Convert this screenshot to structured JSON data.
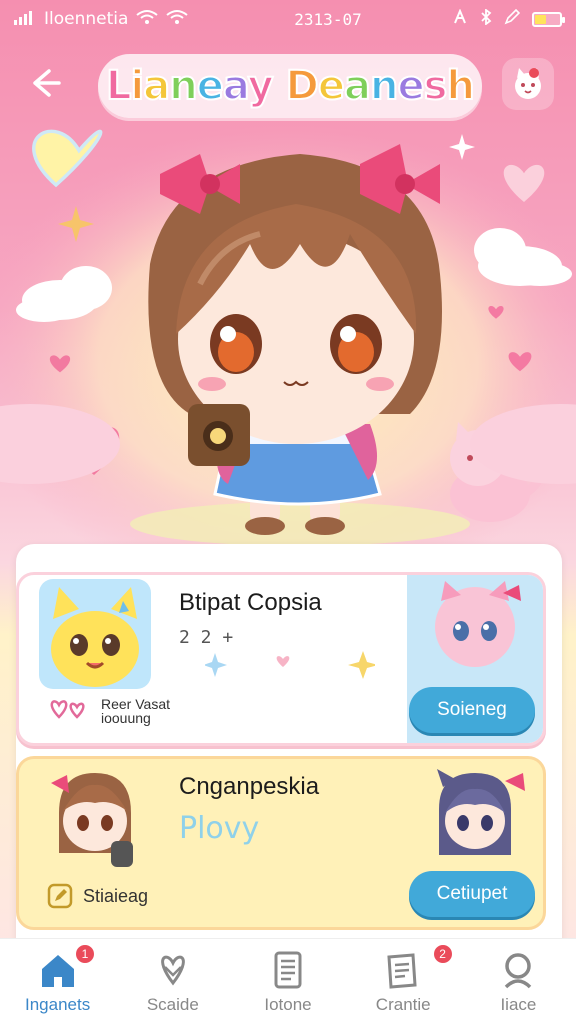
{
  "status_bar": {
    "carrier": "Iloennetia",
    "time": "2313-07",
    "battery_level": 0.45
  },
  "header": {
    "title": "Lianeay Deanesh",
    "back_icon": "back-arrow-icon",
    "profile_icon": "cat-profile-icon"
  },
  "cards": [
    {
      "title": "Btipat Copsia",
      "meta": "2  2 +",
      "footer": [
        "Reer Vasat",
        "ioouung"
      ],
      "button": "Soieneg"
    },
    {
      "title": "Cnganpeskia",
      "subtitle": "Plovy",
      "footer": "Stiaieag",
      "button": "Cetiupet"
    }
  ],
  "bottom_nav": [
    {
      "label": "Inganets",
      "icon": "home-icon",
      "badge": "1",
      "active": true
    },
    {
      "label": "Scaide",
      "icon": "heart-icon",
      "badge": "",
      "active": false
    },
    {
      "label": "Iotone",
      "icon": "document-icon",
      "badge": "",
      "active": false
    },
    {
      "label": "Crantie",
      "icon": "notes-icon",
      "badge": "2",
      "active": false
    },
    {
      "label": "Iiace",
      "icon": "search-icon",
      "badge": "",
      "active": false
    }
  ],
  "colors": {
    "accent": "#41a9d9",
    "pink": "#f58fb0",
    "badge": "#ea4b5a",
    "active_nav": "#3b87c8"
  }
}
